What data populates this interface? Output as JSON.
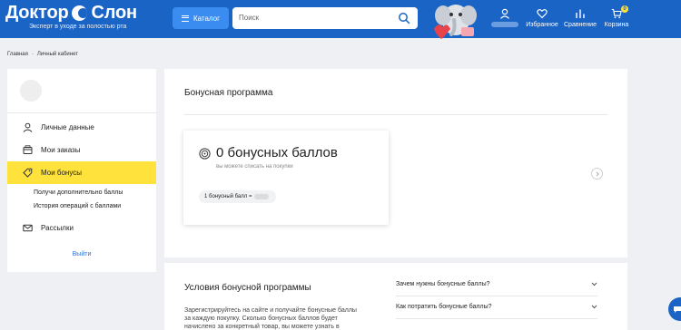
{
  "header": {
    "logo_left": "Доктор",
    "logo_right": "Слон",
    "tagline": "Эксперт в уходе за полостью рта",
    "catalog_label": "Каталог",
    "search_placeholder": "Поиск",
    "favorites_label": "Избранное",
    "compare_label": "Сравнение",
    "cart_label": "Корзина",
    "cart_count": "0"
  },
  "breadcrumb": {
    "home": "Главная",
    "separator": "-",
    "current": "Личный кабинет"
  },
  "sidebar": {
    "items": [
      {
        "label": "Личные данные",
        "icon": "user-icon"
      },
      {
        "label": "Мои заказы",
        "icon": "orders-icon"
      },
      {
        "label": "Мои бонусы",
        "icon": "tag-icon",
        "active": true
      },
      {
        "label": "Рассылки",
        "icon": "mail-icon"
      }
    ],
    "sub_items": [
      "Получи дополнительно баллы",
      "История операций с баллами"
    ],
    "logout": "Выйти"
  },
  "bonus": {
    "title": "Бонусная программа",
    "amount": "0 бонусных баллов",
    "subtitle": "вы можете списать на покупки",
    "rate": "1 бонусный балл ="
  },
  "conditions": {
    "title": "Условия бонусной программы",
    "text": "Зарегистрируйтесь на сайте и получайте бонусные баллы за каждую покупку. Сколько бонусных баллов будет начислено за конкретный товар, вы можете узнать в",
    "faq": [
      "Зачем нужны бонусные баллы?",
      "Как потратить бонусные баллы?"
    ]
  },
  "colors": {
    "brand_blue": "#1a64c6",
    "accent_yellow": "#ffe23c",
    "catalog_blue": "#3b8cf0",
    "page_bg": "#eef0f4"
  }
}
